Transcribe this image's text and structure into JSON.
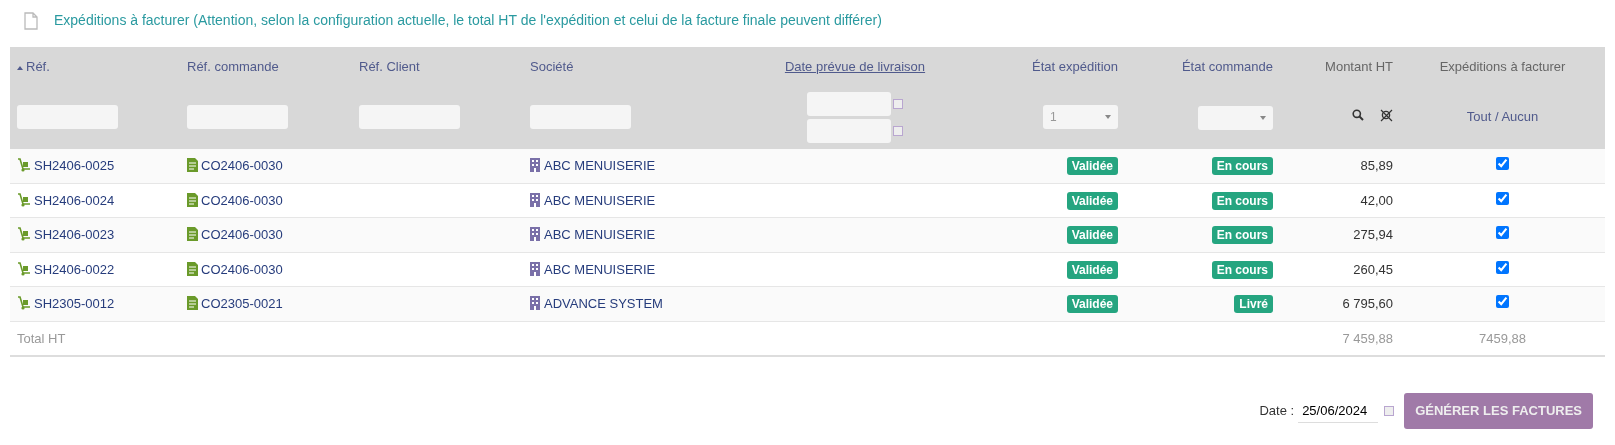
{
  "title": "Expéditions à facturer (Attention, selon la configuration actuelle, le total HT de l'expédition et celui de la facture finale peuvent différer)",
  "table": {
    "columns": [
      {
        "label": "Réf.",
        "kind": "link",
        "sorted": true,
        "filter": {
          "kind": "text"
        }
      },
      {
        "label": "Réf. commande",
        "kind": "link",
        "sorted": false,
        "filter": {
          "kind": "text"
        }
      },
      {
        "label": "Réf. Client",
        "kind": "link",
        "sorted": false,
        "filter": {
          "kind": "text"
        }
      },
      {
        "label": "Société",
        "kind": "link",
        "sorted": false,
        "filter": {
          "kind": "text"
        }
      },
      {
        "label": "Date prévue de livraison",
        "kind": "underlined",
        "sorted": false,
        "filter": {
          "kind": "date_range"
        }
      },
      {
        "label": "État expédition",
        "kind": "link",
        "sorted": false,
        "filter": {
          "kind": "select",
          "value": "1"
        }
      },
      {
        "label": "État commande",
        "kind": "link",
        "sorted": false,
        "filter": {
          "kind": "select"
        }
      },
      {
        "label": "Montant HT",
        "kind": "plain",
        "filter": {
          "kind": "search_buttons"
        }
      },
      {
        "label": "Expéditions à facturer",
        "kind": "plain",
        "filter": {
          "kind": "toggle",
          "text": "Tout / Aucun"
        }
      }
    ],
    "rows": [
      {
        "ref": "SH2406-0025",
        "order": "CO2406-0030",
        "company": "ABC MENUISERIE",
        "shipment_status": "Validée",
        "order_status": "En cours",
        "amount": "85,89",
        "checked": true
      },
      {
        "ref": "SH2406-0024",
        "order": "CO2406-0030",
        "company": "ABC MENUISERIE",
        "shipment_status": "Validée",
        "order_status": "En cours",
        "amount": "42,00",
        "checked": true
      },
      {
        "ref": "SH2406-0023",
        "order": "CO2406-0030",
        "company": "ABC MENUISERIE",
        "shipment_status": "Validée",
        "order_status": "En cours",
        "amount": "275,94",
        "checked": true
      },
      {
        "ref": "SH2406-0022",
        "order": "CO2406-0030",
        "company": "ABC MENUISERIE",
        "shipment_status": "Validée",
        "order_status": "En cours",
        "amount": "260,45",
        "checked": true
      },
      {
        "ref": "SH2305-0012",
        "order": "CO2305-0021",
        "company": "ADVANCE SYSTEM",
        "shipment_status": "Validée",
        "order_status": "Livré",
        "amount": "6 795,60",
        "checked": true
      }
    ],
    "total": {
      "label": "Total HT",
      "amount": "7 459,88",
      "selected_amount": "7459,88"
    }
  },
  "footer": {
    "date_label": "Date :",
    "date_value": "25/06/2024",
    "button": "GÉNÉRER LES FACTURES"
  }
}
